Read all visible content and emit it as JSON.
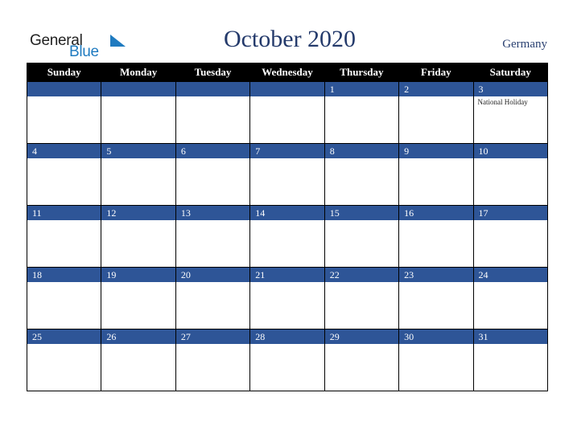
{
  "logo": {
    "word1": "General",
    "word2": "Blue",
    "icon": "blue-triangle-icon"
  },
  "title": "October 2020",
  "country": "Germany",
  "days": [
    "Sunday",
    "Monday",
    "Tuesday",
    "Wednesday",
    "Thursday",
    "Friday",
    "Saturday"
  ],
  "weeks": [
    [
      {
        "d": ""
      },
      {
        "d": ""
      },
      {
        "d": ""
      },
      {
        "d": ""
      },
      {
        "d": "1"
      },
      {
        "d": "2"
      },
      {
        "d": "3",
        "event": "National Holiday"
      }
    ],
    [
      {
        "d": "4"
      },
      {
        "d": "5"
      },
      {
        "d": "6"
      },
      {
        "d": "7"
      },
      {
        "d": "8"
      },
      {
        "d": "9"
      },
      {
        "d": "10"
      }
    ],
    [
      {
        "d": "11"
      },
      {
        "d": "12"
      },
      {
        "d": "13"
      },
      {
        "d": "14"
      },
      {
        "d": "15"
      },
      {
        "d": "16"
      },
      {
        "d": "17"
      }
    ],
    [
      {
        "d": "18"
      },
      {
        "d": "19"
      },
      {
        "d": "20"
      },
      {
        "d": "21"
      },
      {
        "d": "22"
      },
      {
        "d": "23"
      },
      {
        "d": "24"
      }
    ],
    [
      {
        "d": "25"
      },
      {
        "d": "26"
      },
      {
        "d": "27"
      },
      {
        "d": "28"
      },
      {
        "d": "29"
      },
      {
        "d": "30"
      },
      {
        "d": "31"
      }
    ]
  ],
  "colors": {
    "band": "#2e5597",
    "header": "#000000",
    "title": "#243a6b",
    "logo_blue": "#1f7bc0"
  }
}
